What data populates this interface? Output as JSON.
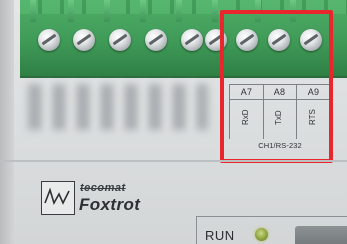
{
  "terminal_labels": {
    "pins": [
      "A7",
      "A8",
      "A9"
    ],
    "signals": [
      "RxD",
      "TxD",
      "RTS"
    ],
    "channel": "CH1/RS-232"
  },
  "brand": {
    "maker": "tecomat",
    "product": "Foxtrot"
  },
  "status": {
    "run_label": "RUN",
    "run_led_color": "#9bb43f"
  },
  "colors": {
    "terminal_green": "#3f9a57",
    "highlight_red": "#e8262c"
  }
}
